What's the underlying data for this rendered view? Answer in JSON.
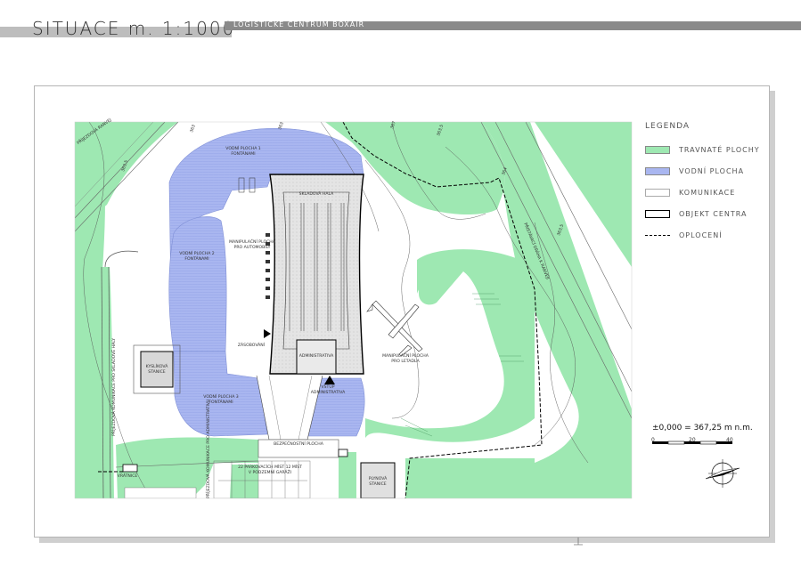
{
  "header": {
    "title": "SITUACE  m. 1:1000",
    "subtitle": "LOGISTICKÉ CENTRUM BOXAIR"
  },
  "legend": {
    "title": "LEGENDA",
    "items": [
      {
        "label": "TRAVNATÉ PLOCHY",
        "color": "#9ee8b2",
        "style": "fill"
      },
      {
        "label": "VODNÍ PLOCHA",
        "color": "#a9b6f0",
        "style": "fill"
      },
      {
        "label": "KOMUNIKACE",
        "color": "#ffffff",
        "style": "outline"
      },
      {
        "label": "OBJEKT CENTRA",
        "color": "#ffffff",
        "style": "bold-outline"
      },
      {
        "label": "OPLOCENÍ",
        "color": "#000000",
        "style": "dashed"
      }
    ]
  },
  "elevation": "±0,000  =  367,25 m n.m.",
  "scale_bar": {
    "ticks": [
      "0",
      "20",
      "40"
    ]
  },
  "colors": {
    "grass": "#9ee8b2",
    "water": "#a9b6f0",
    "building": "#e8e8e8"
  },
  "labels": {
    "skladova_hala": "SKLADOVÁ HALA",
    "administrativa": "ADMINISTRATIVA",
    "vstup_admin": "VSTUP\nADMINISTRATIVA",
    "zasobovani": "ZÁSOBOVÁNÍ",
    "manip_auto": "MANIPULAČNÍ PLOCHA\nPRO AUTOMOBILY",
    "manip_letadla": "MANIPULAČNÍ PLOCHA\nPRO LETADLA",
    "vodni_plocha_1": "VODNÍ PLOCHA 1\nFONTÁNAMI",
    "vodni_plocha_2": "VODNÍ PLOCHA 2\nFONTÁNAMI",
    "vodni_plocha_3": "VODNÍ PLOCHA 3\nFONTÁNAMI",
    "kyslikova_stanice": "KYSLÍKOVÁ\nSTANICE",
    "plynova_stanice": "PLYNOVÁ\nSTANICE",
    "vratnice": "VRÁTNICE",
    "bezpecnostni_plocha": "BEZPEČNOSTNÍ PLOCHA",
    "parkovani": "22 PARKOVACÍCH MÍST 12 MÍST\nV PODZEMNÍ GARÁŽI",
    "prijezd_haly": "PŘÍJEZDOVÁ KOMUNIKACE PRO SKLADOVÉ HALY",
    "prijezd_admin": "PŘÍJEZDOVÁ KOMUNIKACE PRO ADMINISTRATIVU",
    "prijezd_ranveje": "PŘÍJEZDOVÁ RANVEJ",
    "pristavaci_draha": "PŘISTÁVACÍ DRÁHA K RANVEJI",
    "contours": [
      "363",
      "363,5",
      "363",
      "363,5",
      "367",
      "364",
      "363,5",
      "364"
    ]
  }
}
